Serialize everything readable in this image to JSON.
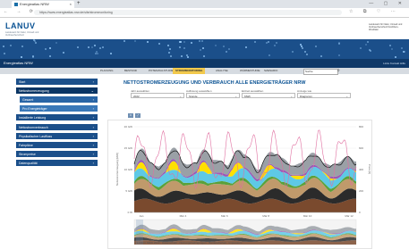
{
  "browser": {
    "tab_title": "Energieatlas NRW",
    "tab_close": "×",
    "new_tab": "+",
    "window_controls": "— ▢ ✕",
    "nav_buttons": "← → ⟳ ⌂",
    "url": "https://www.energieatlas.nrw.de/site/strommonitoring",
    "toolbar_icons": "☆ ⧉ ♡ ⋯"
  },
  "site": {
    "logo": "LANUV",
    "logo_sub": "Landesamt für Natur, Umwelt und Verbraucherschutz",
    "ministry": "Landesamt für Natur, Umwelt und Verbraucherschutz Nordrhein-Westfalen",
    "bar_title": "Energieatlas NRW",
    "bar_right": "Links  Kontakt  Hilfe",
    "topnav": [
      {
        "label": "PLANUNG"
      },
      {
        "label": "BESTAND"
      },
      {
        "label": "POTENZIALSTUDIE"
      },
      {
        "label": "STROMMONITORING",
        "active": true
      },
      {
        "label": "ANALYSE"
      },
      {
        "label": "WÄRMESTUDIE"
      },
      {
        "label": "SZENARIO"
      }
    ],
    "search_placeholder": "Suche"
  },
  "sidebar": {
    "items": [
      {
        "label": "Start",
        "level": 0
      },
      {
        "label": "Nettostromerzeugung",
        "level": 0,
        "active": true
      },
      {
        "label": "Gesamt",
        "level": 1
      },
      {
        "label": "Pro Energieträger",
        "level": 2
      },
      {
        "label": "Installierte Leistung",
        "level": 0
      },
      {
        "label": "Nettostromverbrauch",
        "level": 0
      },
      {
        "label": "Physikalischer Lastfluss",
        "level": 0
      },
      {
        "label": "Fahrpläne",
        "level": 0
      },
      {
        "label": "Strompreise",
        "level": 0
      },
      {
        "label": "Datenqualität",
        "level": 0
      }
    ]
  },
  "main": {
    "title": "NETTOSTROMERZEUGUNG UND VERBRAUCH ALLE ENERGIETRÄGER NRW",
    "filters": [
      {
        "label": "Jahr auswählen",
        "value": "2022"
      },
      {
        "label": "Auflösung auswählen",
        "value": "Stunde"
      },
      {
        "label": "Einheit auswählen",
        "value": "MWh"
      },
      {
        "label": "Anzeige wie",
        "value": "Diagramm"
      }
    ],
    "chart_tools": [
      "≡",
      "⤢"
    ]
  },
  "chart_data": {
    "type": "area",
    "y_left_label": "Nettostromerzeugung [MW]",
    "y_right_label": "Preis [€]",
    "y_left_ticks": [
      "20 GW",
      "15 GW",
      "10 GW",
      "5 GW",
      "0 W"
    ],
    "y_right_ticks": [
      "800",
      "600",
      "400",
      "200",
      "0"
    ],
    "x_ticks": [
      "Jan\n2022",
      "Mär 4",
      "Mär 6",
      "Mär 8",
      "Mär 10",
      "Mär 12"
    ],
    "series_colors": {
      "braunkohle": "#7a4a2e",
      "steinkohle": "#2b2b2b",
      "gas": "#c09a6b",
      "wind": "#5ec9e6",
      "solar": "#ffe000",
      "biomasse": "#5aa13b",
      "other": "#9b59b6",
      "import": "#9aa0a6",
      "load": "#6b8fb5"
    }
  },
  "footer": "© LANUV NRW 2022 · Datenschutz · Nutzungsbedingungen · Barrierefreiheit · Impressum"
}
